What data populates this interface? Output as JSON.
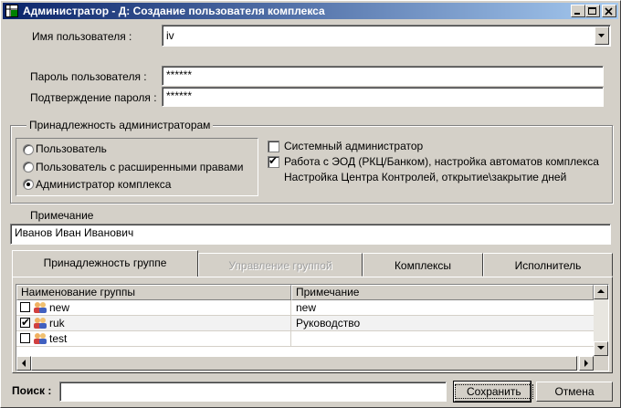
{
  "window": {
    "title": "Администратор - Д: Создание пользователя комплекса",
    "icon": "app-grid-icon"
  },
  "form": {
    "username_label": "Имя пользователя :",
    "username_value": "iv",
    "password_label": "Пароль пользователя :",
    "password_value": "******",
    "confirm_label": "Подтверждение пароля :",
    "confirm_value": "******"
  },
  "admin_group": {
    "legend": "Принадлежность администраторам",
    "radios": [
      {
        "label": "Пользователь",
        "selected": false
      },
      {
        "label": "Пользователь с расширенными правами",
        "selected": false
      },
      {
        "label": "Администратор комплекса",
        "selected": true
      }
    ],
    "checks": [
      {
        "label": "Системный администратор",
        "checked": false
      },
      {
        "label": "Работа с ЭОД (РКЦ/Банком), настройка автоматов комплекса",
        "checked": true
      },
      {
        "label": "Настройка Центра Контролей, открытие\\закрытие дней",
        "checked": false
      }
    ]
  },
  "note": {
    "label": "Примечание",
    "value": "Иванов Иван Иванович"
  },
  "tabs": [
    {
      "label": "Принадлежность группе",
      "active": true,
      "disabled": false
    },
    {
      "label": "Управление группой",
      "active": false,
      "disabled": true
    },
    {
      "label": "Комплексы",
      "active": false,
      "disabled": false
    },
    {
      "label": "Исполнитель",
      "active": false,
      "disabled": false
    }
  ],
  "grid": {
    "columns": [
      "Наименование группы",
      "Примечание"
    ],
    "rows": [
      {
        "name": "new",
        "note": "new",
        "checked": false
      },
      {
        "name": "ruk",
        "note": "Руководство",
        "checked": true
      },
      {
        "name": "test",
        "note": "",
        "checked": false
      }
    ]
  },
  "footer": {
    "search_label": "Поиск :",
    "search_value": "",
    "save_label": "Сохранить",
    "cancel_label": "Отмена"
  },
  "colors": {
    "titlebar_start": "#0a246a",
    "titlebar_end": "#a6caf0",
    "face": "#d4d0c8"
  }
}
